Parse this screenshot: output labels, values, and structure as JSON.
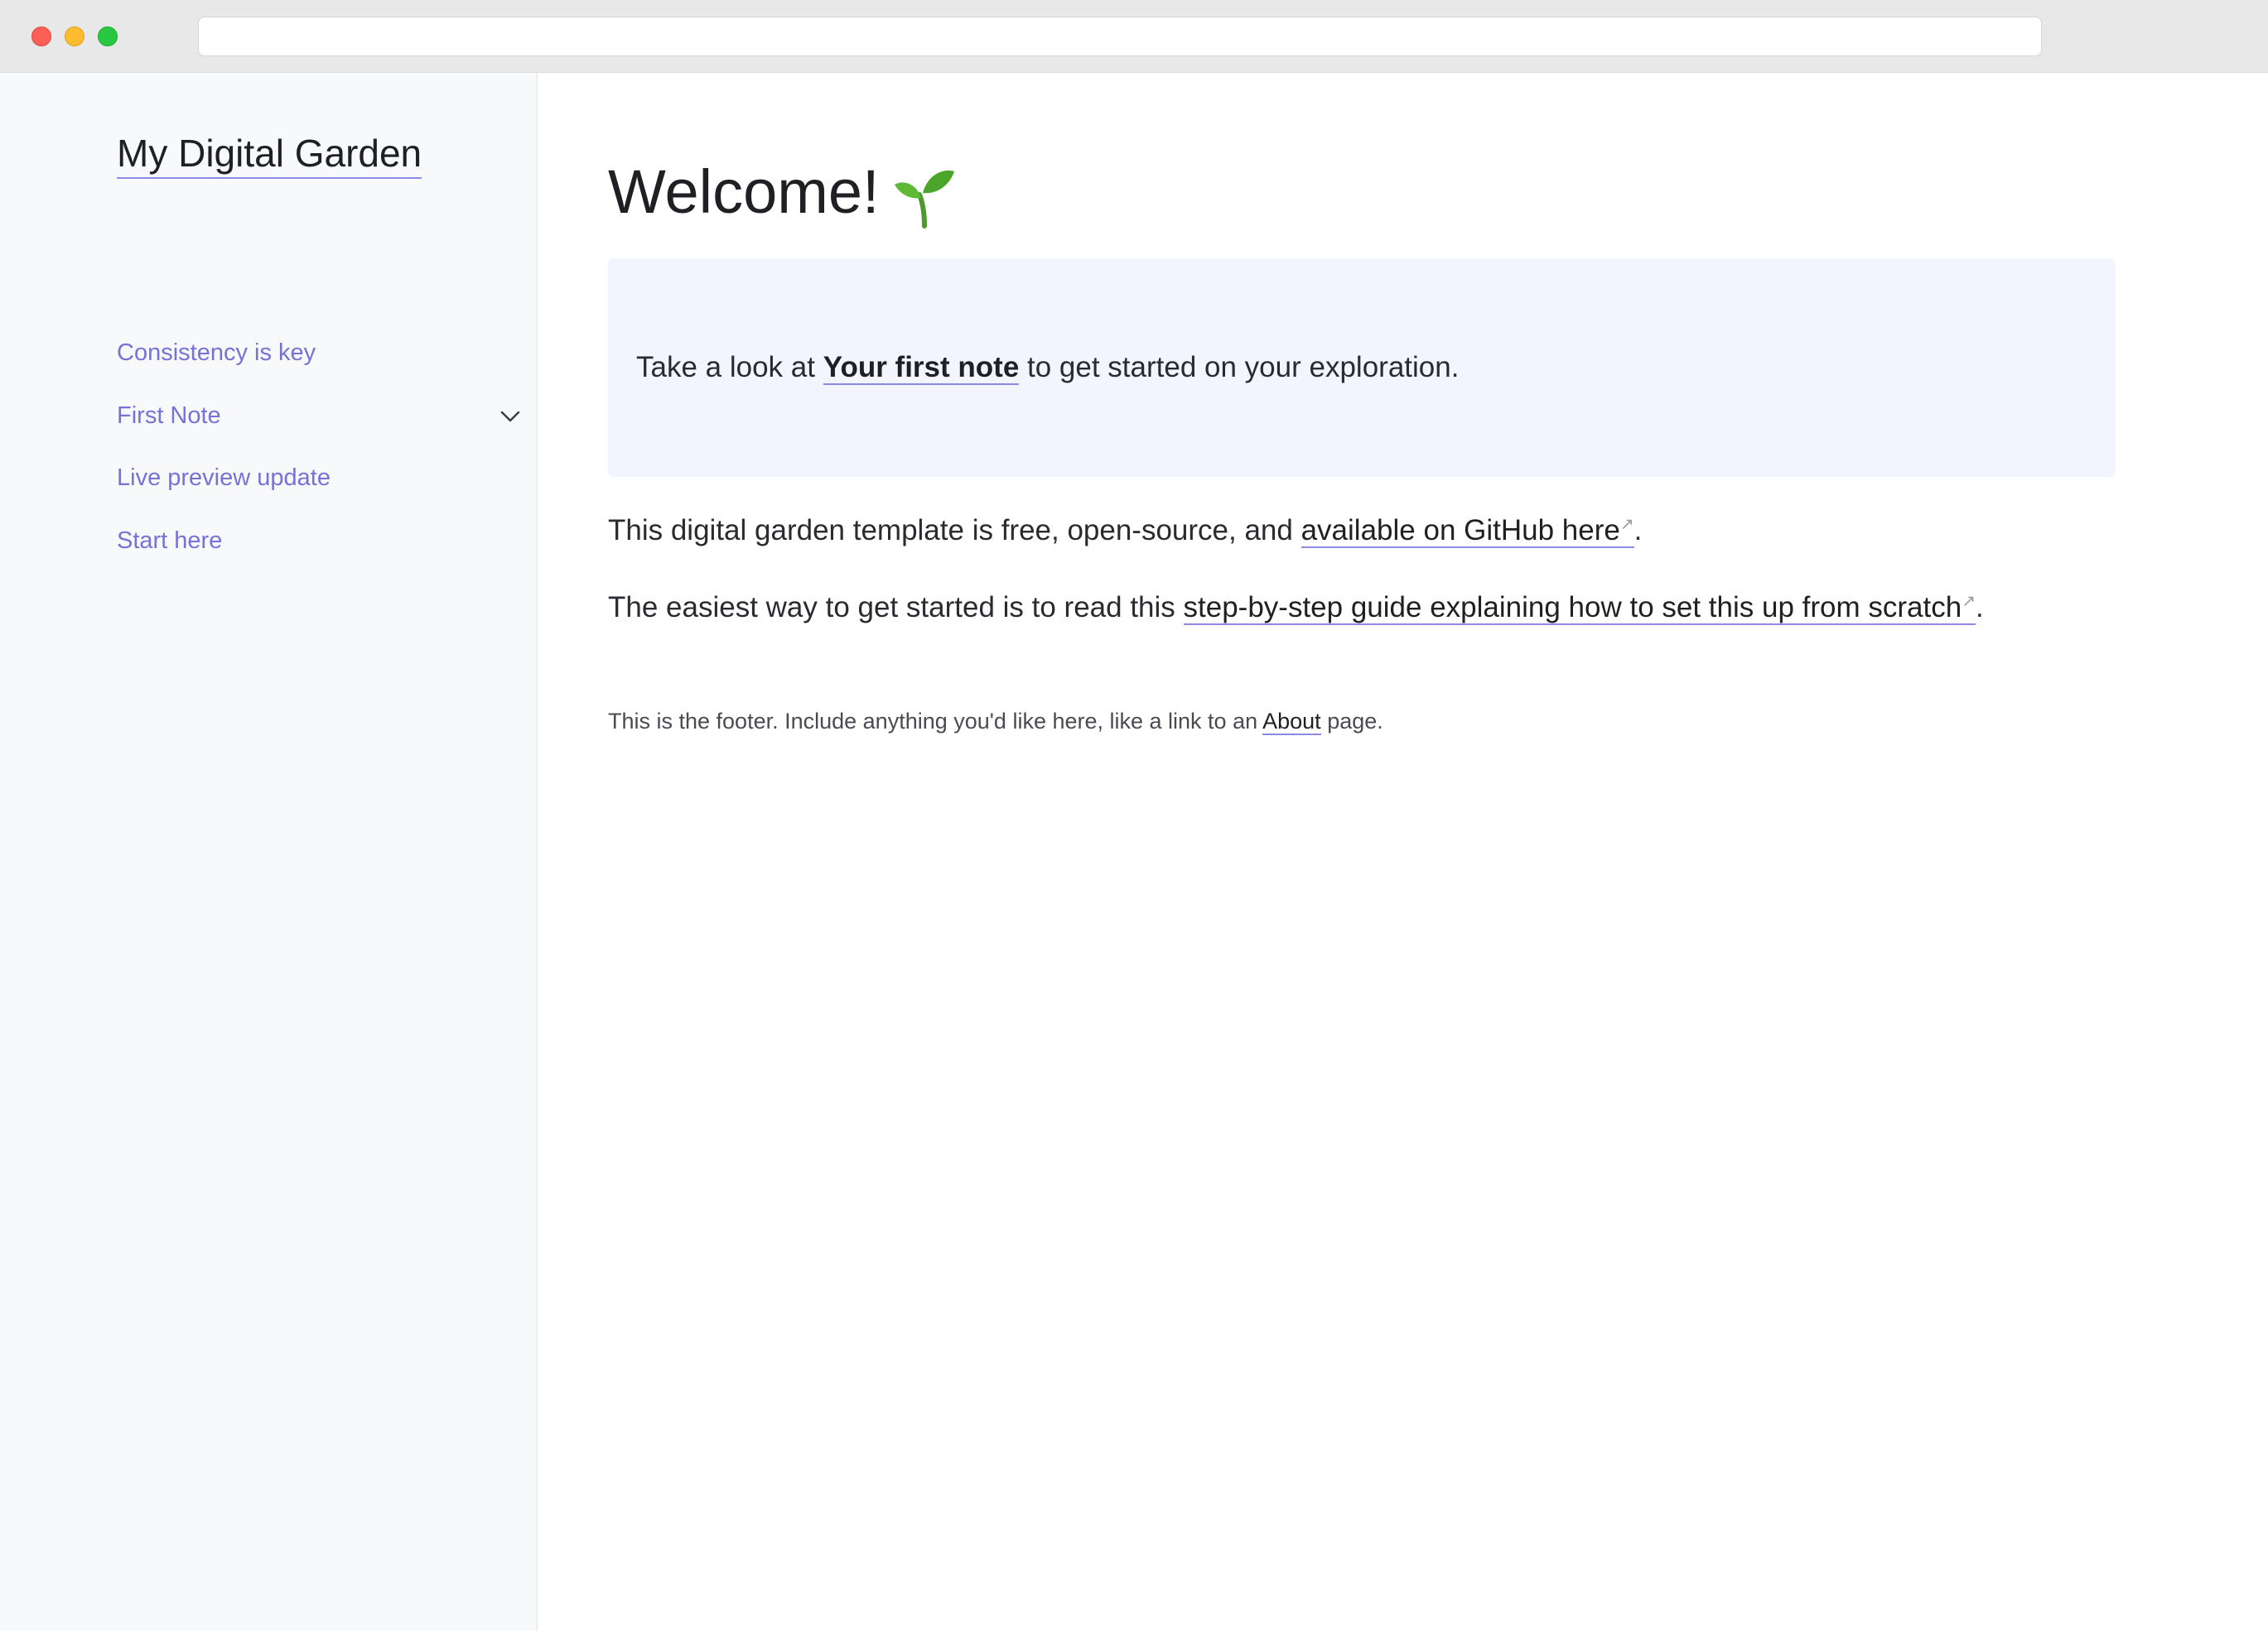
{
  "browser": {
    "url": ""
  },
  "sidebar": {
    "site_title": "My Digital Garden",
    "items": [
      {
        "label": "Consistency is key"
      },
      {
        "label": "First Note",
        "expandable": true,
        "icon": "chevron-down-icon"
      },
      {
        "label": "Live preview update"
      },
      {
        "label": "Start here"
      }
    ]
  },
  "main": {
    "title": "Welcome!",
    "title_icon": "sprout-icon",
    "callout": {
      "prefix": "Take a look at",
      "link": "Your first note",
      "suffix": "to get started on your exploration."
    },
    "paragraph1": {
      "prefix": "This digital garden template is free, open-source, and",
      "link": "available on GitHub here",
      "suffix": "."
    },
    "paragraph2": {
      "prefix": "The easiest way to get started is to read this",
      "link": "step-by-step guide explaining how to set this up from scratch",
      "suffix": "."
    },
    "external_link_icon": "↗"
  },
  "footer": {
    "prefix": "This is the footer. Include anything you'd like here, like a link to an",
    "link": "About",
    "suffix": "page."
  },
  "colors": {
    "accent": "#7773d6",
    "underline": "#8d8ae6",
    "callout_bg": "#f2f5fd",
    "sidebar_bg": "#f8f9fb"
  }
}
